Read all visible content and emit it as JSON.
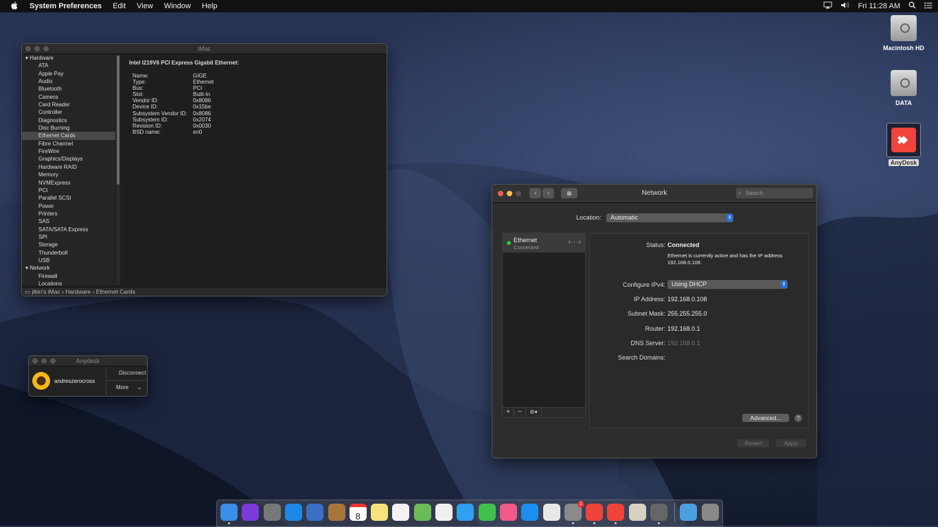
{
  "menubar": {
    "apple": "",
    "app": "System Preferences",
    "items": [
      "Edit",
      "View",
      "Window",
      "Help"
    ],
    "clock": "Fri 11:28 AM"
  },
  "desktop": {
    "icons": [
      {
        "label": "Macintosh HD",
        "icon": "hard-drive-icon"
      },
      {
        "label": "DATA",
        "icon": "hard-drive-icon"
      },
      {
        "label": "AnyDesk",
        "icon": "anydesk-icon"
      }
    ]
  },
  "sysinfo": {
    "title": "iMac",
    "tree": [
      {
        "label": "Hardware",
        "group": true
      },
      {
        "label": "ATA"
      },
      {
        "label": "Apple Pay"
      },
      {
        "label": "Audio"
      },
      {
        "label": "Bluetooth"
      },
      {
        "label": "Camera"
      },
      {
        "label": "Card Reader"
      },
      {
        "label": "Controller"
      },
      {
        "label": "Diagnostics"
      },
      {
        "label": "Disc Burning"
      },
      {
        "label": "Ethernet Cards",
        "selected": true
      },
      {
        "label": "Fibre Channel"
      },
      {
        "label": "FireWire"
      },
      {
        "label": "Graphics/Displays"
      },
      {
        "label": "Hardware RAID"
      },
      {
        "label": "Memory"
      },
      {
        "label": "NVMExpress"
      },
      {
        "label": "PCI"
      },
      {
        "label": "Parallel SCSI"
      },
      {
        "label": "Power"
      },
      {
        "label": "Printers"
      },
      {
        "label": "SAS"
      },
      {
        "label": "SATA/SATA Express"
      },
      {
        "label": "SPI"
      },
      {
        "label": "Storage"
      },
      {
        "label": "Thunderbolt"
      },
      {
        "label": "USB"
      },
      {
        "label": "Network",
        "group": true
      },
      {
        "label": "Firewall"
      },
      {
        "label": "Locations"
      }
    ],
    "detail_title": "Intel I219V6 PCI Express Gigabit Ethernet:",
    "properties": [
      {
        "k": "Name:",
        "v": "GIGE"
      },
      {
        "k": "Type:",
        "v": "Ethernet"
      },
      {
        "k": "Bus:",
        "v": "PCI"
      },
      {
        "k": "Slot:",
        "v": "Built-In"
      },
      {
        "k": "Vendor ID:",
        "v": "0x8086"
      },
      {
        "k": "Device ID:",
        "v": "0x15be"
      },
      {
        "k": "Subsystem Vendor ID:",
        "v": "0x8086"
      },
      {
        "k": "Subsystem ID:",
        "v": "0x2074"
      },
      {
        "k": "Revision ID:",
        "v": "0x0030"
      },
      {
        "k": "BSD name:",
        "v": "en0"
      }
    ],
    "path": [
      "jibin's iMac",
      "Hardware",
      "Ethernet Cards"
    ]
  },
  "anydesk": {
    "title": "Anydesk",
    "user": "andreszerocross",
    "disconnect": "Disconnect",
    "more": "More"
  },
  "network": {
    "title": "Network",
    "search_placeholder": "Search",
    "location_label": "Location:",
    "location_value": "Automatic",
    "service": {
      "name": "Ethernet",
      "status": "Connected"
    },
    "status_label": "Status:",
    "status_value": "Connected",
    "status_desc": "Ethernet is currently active and has the IP address 192.168.0.108.",
    "configure_label": "Configure IPv4:",
    "configure_value": "Using DHCP",
    "ip_label": "IP Address:",
    "ip_value": "192.168.0.108",
    "mask_label": "Subnet Mask:",
    "mask_value": "255.255.255.0",
    "router_label": "Router:",
    "router_value": "192.168.0.1",
    "dns_label": "DNS Server:",
    "dns_value": "192.168.0.1",
    "domains_label": "Search Domains:",
    "advanced": "Advanced...",
    "help": "?",
    "revert": "Revert",
    "apply": "Apply",
    "add": "+",
    "remove": "−",
    "gear": "⚙▾"
  },
  "dock": {
    "apps": [
      {
        "name": "finder-icon",
        "color": "#3a8ee6"
      },
      {
        "name": "siri-icon",
        "color": "#7a3bd8"
      },
      {
        "name": "launchpad-icon",
        "color": "#777"
      },
      {
        "name": "safari-icon",
        "color": "#1e88e5"
      },
      {
        "name": "preview-icon",
        "color": "#3a6fc4"
      },
      {
        "name": "contacts-icon",
        "color": "#a8763b"
      },
      {
        "name": "calendar-icon",
        "color": "#ffffff"
      },
      {
        "name": "notes-icon",
        "color": "#f5e27a"
      },
      {
        "name": "reminders-icon",
        "color": "#f2f2f2"
      },
      {
        "name": "maps-icon",
        "color": "#6cbb5a"
      },
      {
        "name": "photos-icon",
        "color": "#f0f0f0"
      },
      {
        "name": "messages-icon",
        "color": "#2ea0f0"
      },
      {
        "name": "facetime-icon",
        "color": "#3fbf4c"
      },
      {
        "name": "itunes-icon",
        "color": "#f05a8a"
      },
      {
        "name": "app-store-icon",
        "color": "#1c8ef0"
      },
      {
        "name": "textedit-icon",
        "color": "#e8e8e8"
      },
      {
        "name": "system-preferences-icon",
        "color": "#8a8a8a"
      },
      {
        "name": "anydesk-dock-icon",
        "color": "#ef443b"
      },
      {
        "name": "anydesk-dock-icon-2",
        "color": "#ef443b"
      },
      {
        "name": "script-editor-icon",
        "color": "#d8d0c0"
      },
      {
        "name": "utility-icon",
        "color": "#666"
      },
      {
        "name": "downloads-folder-icon",
        "color": "#4aa0e0"
      },
      {
        "name": "trash-icon",
        "color": "#888"
      }
    ],
    "calendar_day": "8",
    "badge": "1"
  }
}
